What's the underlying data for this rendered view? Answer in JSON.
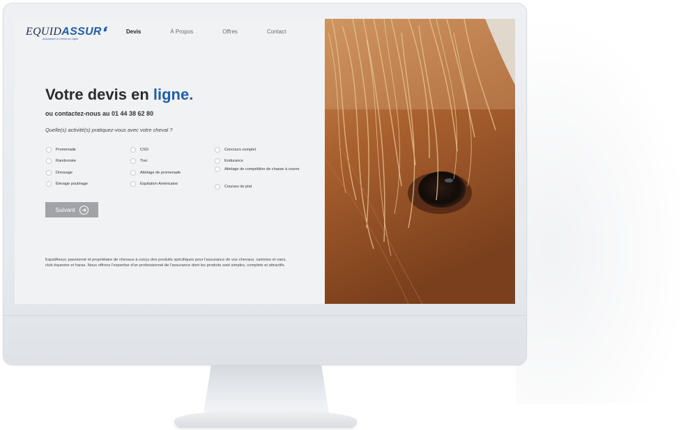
{
  "logo": {
    "part1": "EQUID",
    "part2": "ASSUR",
    "tagline": "Assurance à cheval en Ligne"
  },
  "nav": {
    "items": [
      "Devis",
      "À Propos",
      "Offres",
      "Contact"
    ]
  },
  "hero": {
    "title_main": "Votre devis en ",
    "title_accent": "ligne.",
    "contact_prefix": "ou contactez-nous au ",
    "phone": "01 44 38 62 80",
    "question": "Quelle(s) activité(s) pratiquez-vous avec votre cheval ?"
  },
  "activities": {
    "col1": [
      "Promenade",
      "Randonnée",
      "Dressage",
      "Élevage poulinage"
    ],
    "col2": [
      "CSO",
      "Trec",
      "Attelage de promenade",
      "Equitation Américaine"
    ],
    "col3": [
      "Concours complet",
      "Endurance",
      "Attelage de compétition de chasse à courre",
      "Courses de plat"
    ]
  },
  "actions": {
    "next_label": "Suivant"
  },
  "about": {
    "text": "EquidAssur, passionné et propriétaire de chevaux à conçu des produits spécifiques pour l'assurance de vos chevaux, camions et vans, club équestre et haras. Nous offrons l'expertise d'un professionnel de l'assurance dont les produits sont simples, complets et attractifs."
  },
  "colors": {
    "accent": "#1f5fa9",
    "button": "#a2a3a6",
    "background": "#f1f2f3"
  },
  "icons": {
    "next": "arrow-right-circle-icon",
    "photo": "horse-eye-photo"
  }
}
